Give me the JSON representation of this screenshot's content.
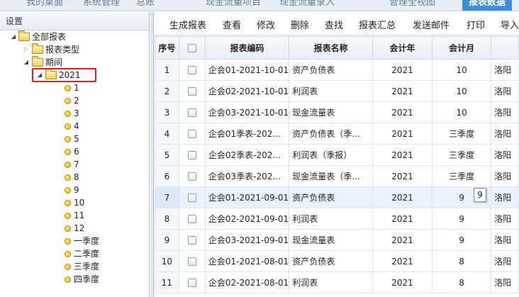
{
  "top_tabs": [
    {
      "label": "我的桌面",
      "active": false
    },
    {
      "label": "系统管理",
      "active": false
    },
    {
      "label": "总账",
      "active": false
    },
    {
      "label": "现金流量项目",
      "active": false
    },
    {
      "label": "现金流量录入",
      "active": false
    },
    {
      "label": "管理全视图",
      "active": false
    },
    {
      "label": "报表数据",
      "active": true
    }
  ],
  "left_panel": {
    "title": "设置",
    "tree": {
      "root": "全部报表",
      "report_types": "报表类型",
      "period": "期间",
      "year": "2021",
      "months": [
        "1",
        "2",
        "3",
        "4",
        "5",
        "6",
        "7",
        "8",
        "9",
        "10",
        "11",
        "12"
      ],
      "quarters": [
        "一季度",
        "二季度",
        "三季度",
        "四季度"
      ]
    }
  },
  "toolbar": [
    "生成报表",
    "查看",
    "修改",
    "删除",
    "查找",
    "报表汇总",
    "发送邮件",
    "打印",
    "导入"
  ],
  "grid": {
    "columns": [
      "序号",
      "",
      "报表编码",
      "报表名称",
      "会计年",
      "会计月",
      ""
    ],
    "rows": [
      {
        "seq": "1",
        "code": "企会01-2021-10-01",
        "name": "资产负债表",
        "year": "2021",
        "month": "10",
        "extra": "洛阳"
      },
      {
        "seq": "2",
        "code": "企会02-2021-10-01",
        "name": "利润表",
        "year": "2021",
        "month": "10",
        "extra": "洛阳"
      },
      {
        "seq": "3",
        "code": "企会03-2021-10-01",
        "name": "现金流量表",
        "year": "2021",
        "month": "10",
        "extra": "洛阳"
      },
      {
        "seq": "4",
        "code": "企会01季表-202...",
        "name": "资产负债表（季...",
        "year": "2021",
        "month": "三季度",
        "extra": "洛阳"
      },
      {
        "seq": "5",
        "code": "企会02季表-202...",
        "name": "利润表（季报）",
        "year": "2021",
        "month": "三季度",
        "extra": "洛阳"
      },
      {
        "seq": "6",
        "code": "企会03季表-202...",
        "name": "现金流量表（季...",
        "year": "2021",
        "month": "三季度",
        "extra": "洛阳"
      },
      {
        "seq": "7",
        "code": "企会01-2021-09-01",
        "name": "资产负债表",
        "year": "2021",
        "month": "9",
        "extra": "洛阳"
      },
      {
        "seq": "8",
        "code": "企会02-2021-09-01",
        "name": "利润表",
        "year": "2021",
        "month": "9",
        "extra": "洛阳"
      },
      {
        "seq": "9",
        "code": "企会03-2021-09-01",
        "name": "现金流量表",
        "year": "2021",
        "month": "9",
        "extra": "洛阳"
      },
      {
        "seq": "10",
        "code": "企会01-2021-08-01",
        "name": "资产负债表",
        "year": "2021",
        "month": "8",
        "extra": "洛阳"
      },
      {
        "seq": "11",
        "code": "企会02-2021-08-01",
        "name": "利润表",
        "year": "2021",
        "month": "8",
        "extra": "洛阳"
      }
    ],
    "highlighted_row": 6,
    "tooltip": "9"
  },
  "colors": {
    "active_tab": "#3b8fd9",
    "selection_outline": "#e02020",
    "row_highlight": "#eaf2fc"
  }
}
